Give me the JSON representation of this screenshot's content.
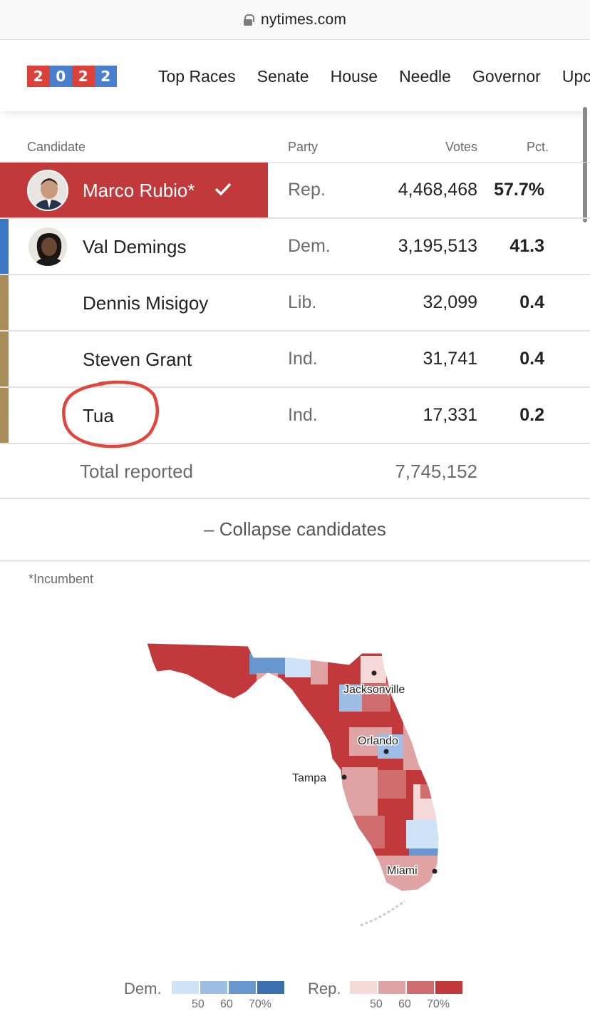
{
  "browser": {
    "url": "nytimes.com"
  },
  "nav": {
    "logo_digits": [
      "2",
      "0",
      "2",
      "2"
    ],
    "links": [
      "Top Races",
      "Senate",
      "House",
      "Needle",
      "Governor",
      "Upc"
    ]
  },
  "table": {
    "headers": {
      "candidate": "Candidate",
      "party": "Party",
      "votes": "Votes",
      "pct": "Pct."
    },
    "rows": [
      {
        "name": "Marco Rubio*",
        "party": "Rep.",
        "votes": "4,468,468",
        "pct": "57.7%",
        "winner": true,
        "bar_color": "#c1393a"
      },
      {
        "name": "Val Demings",
        "party": "Dem.",
        "votes": "3,195,513",
        "pct": "41.3",
        "winner": false,
        "bar_color": "#3a78c3"
      },
      {
        "name": "Dennis Misigoy",
        "party": "Lib.",
        "votes": "32,099",
        "pct": "0.4",
        "winner": false,
        "bar_color": "#a88d58"
      },
      {
        "name": "Steven Grant",
        "party": "Ind.",
        "votes": "31,741",
        "pct": "0.4",
        "winner": false,
        "bar_color": "#a88d58"
      },
      {
        "name": "Tua",
        "party": "Ind.",
        "votes": "17,331",
        "pct": "0.2",
        "winner": false,
        "bar_color": "#a88d58"
      }
    ],
    "total_label": "Total reported",
    "total_value": "7,745,152"
  },
  "collapse_label": "– Collapse candidates",
  "footnote": "*Incumbent",
  "map": {
    "cities": [
      "Jacksonville",
      "Orlando",
      "Tampa",
      "Miami"
    ]
  },
  "legend": {
    "dem_label": "Dem.",
    "rep_label": "Rep.",
    "ticks": [
      "50",
      "60",
      "70%"
    ],
    "dem_colors": [
      "#cfe3f8",
      "#9dbde4",
      "#6896cf",
      "#3a6fb0"
    ],
    "rep_colors": [
      "#f5d9d9",
      "#e0a3a4",
      "#cf6d6e",
      "#c1393a"
    ]
  }
}
